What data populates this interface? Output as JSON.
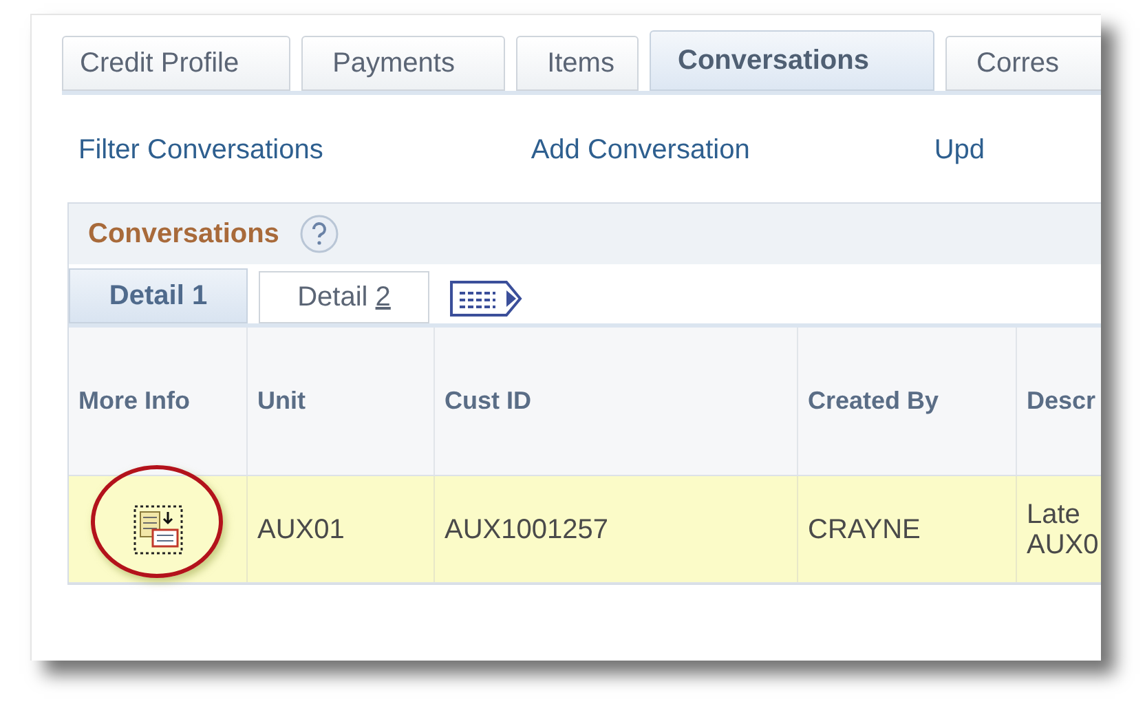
{
  "tabs": [
    {
      "label": "Credit Profile",
      "selected": false
    },
    {
      "label": "Payments",
      "selected": false
    },
    {
      "label": "Items",
      "selected": false
    },
    {
      "label": "Conversations",
      "selected": true
    },
    {
      "label": "Corres",
      "selected": false
    }
  ],
  "links": [
    "Filter Conversations",
    "Add Conversation",
    "Upd"
  ],
  "grid": {
    "title": "Conversations",
    "detail_tabs": [
      {
        "label": "Detail",
        "hotkey": "1",
        "selected": true
      },
      {
        "label": "Detail",
        "hotkey": "2",
        "selected": false
      }
    ],
    "columns": [
      "More Info",
      "Unit",
      "Cust ID",
      "Created By",
      "Descr"
    ],
    "rows": [
      {
        "unit": "AUX01",
        "cust_id": "AUX1001257",
        "created_by": "CRAYNE",
        "descr": "Late AUX0"
      }
    ]
  }
}
